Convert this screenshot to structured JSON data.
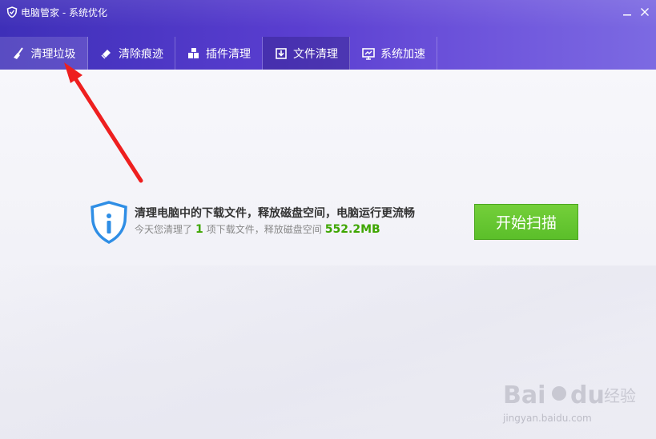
{
  "window": {
    "title": "电脑管家 - 系统优化",
    "minimize_glyph": "—",
    "close_glyph": "✕"
  },
  "tabs": [
    {
      "label": "清理垃圾",
      "icon": "broom-icon"
    },
    {
      "label": "清除痕迹",
      "icon": "eraser-icon"
    },
    {
      "label": "插件清理",
      "icon": "plugin-icon"
    },
    {
      "label": "文件清理",
      "icon": "file-download-icon"
    },
    {
      "label": "系统加速",
      "icon": "monitor-icon"
    }
  ],
  "main": {
    "headline": "清理电脑中的下载文件，释放磁盘空间，电脑运行更流畅",
    "sub_prefix": "今天您清理了",
    "cleaned_count": "1",
    "sub_middle": "项下载文件，释放磁盘空间",
    "freed_size": "552.2MB",
    "scan_button": "开始扫描"
  },
  "watermark": {
    "text": "jingyan.baidu.com"
  },
  "colors": {
    "titlebar": "#5a3ed0",
    "accent_green": "#5bbf2a",
    "arrow": "#ee1f1f"
  }
}
